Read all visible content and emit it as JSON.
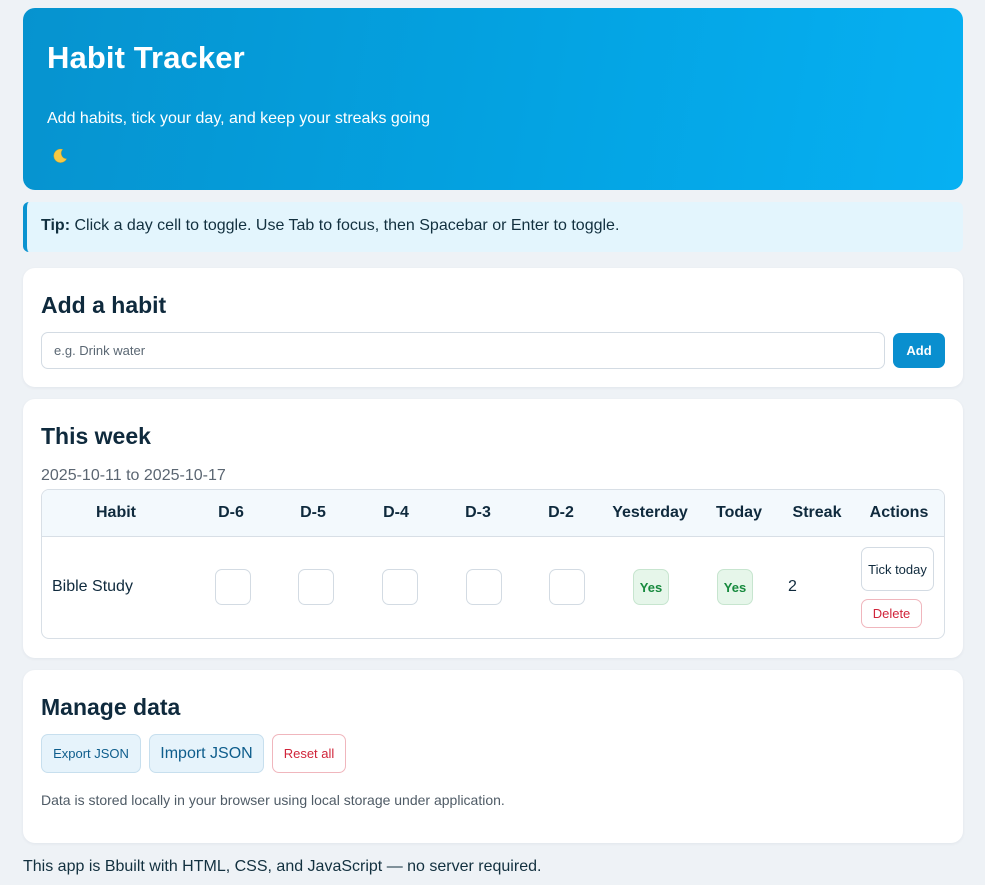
{
  "header": {
    "title": "Habit Tracker",
    "subtitle": "Add habits, tick your day, and keep your streaks going",
    "theme_icon": "crescent-moon-icon"
  },
  "tip": {
    "label": "Tip:",
    "text": " Click a day cell to toggle. Use Tab to focus, then Spacebar or Enter to toggle."
  },
  "add_habit": {
    "title": "Add a habit",
    "placeholder": "e.g. Drink water",
    "value": "",
    "button_label": "Add"
  },
  "week": {
    "title": "This week",
    "range": "2025-10-11 to 2025-10-17",
    "columns": [
      "Habit",
      "D-6",
      "D-5",
      "D-4",
      "D-3",
      "D-2",
      "Yesterday",
      "Today",
      "Streak",
      "Actions"
    ],
    "rows": [
      {
        "name": "Bible Study",
        "days": [
          "",
          "",
          "",
          "",
          "",
          "Yes",
          "Yes"
        ],
        "streak": "2",
        "tick_label": "Tick today",
        "delete_label": "Delete"
      }
    ]
  },
  "manage": {
    "title": "Manage data",
    "export_label": "Export JSON",
    "import_label": "Import JSON",
    "reset_label": "Reset all",
    "note": "Data is stored locally in your browser using local storage under application."
  },
  "footer": {
    "text": "This app is Bbuilt with HTML, CSS, and JavaScript — no server required."
  },
  "colors": {
    "header_gradient_start": "#0693cf",
    "header_gradient_end": "#06b0f2",
    "accent": "#0a8fcf",
    "done_background": "#e6f6ea",
    "done_text": "#178a3e",
    "danger": "#d0243a",
    "page_background": "#eef2f6"
  }
}
